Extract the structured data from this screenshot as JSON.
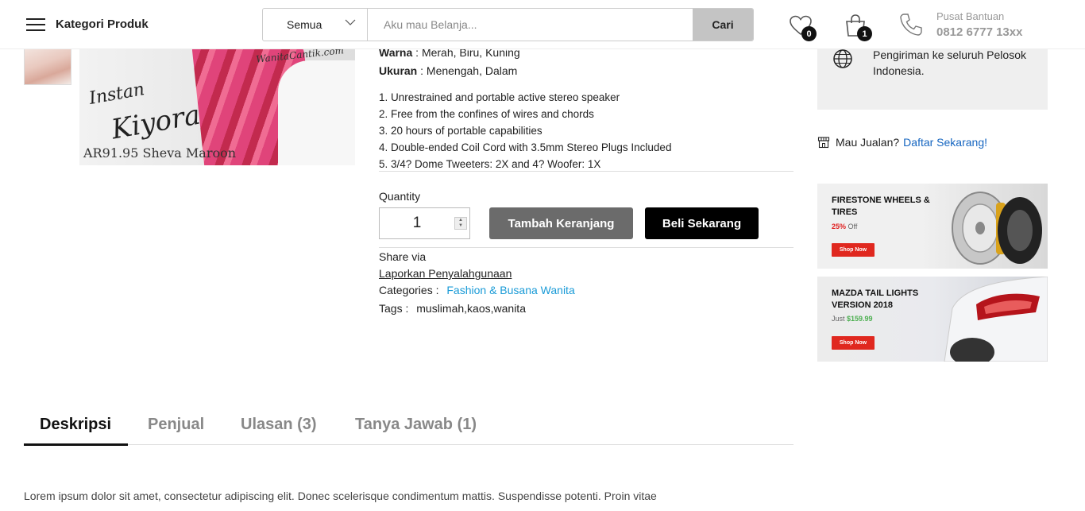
{
  "header": {
    "category_menu_label": "Kategori Produk",
    "search": {
      "category_selected": "Semua",
      "placeholder": "Aku mau Belanja...",
      "button_label": "Cari"
    },
    "wishlist_count": "0",
    "cart_count": "1",
    "help": {
      "label": "Pusat Bantuan",
      "phone": "0812 6777 13xx"
    }
  },
  "product_image": {
    "watermark": "WanitaCantik.com",
    "text_line1": "Instan",
    "text_line2": "Kiyora",
    "caption": "AR91.95 Sheva Maroon"
  },
  "product": {
    "color_label": "Warna",
    "color_value": " : Merah, Biru, Kuning",
    "size_label": "Ukuran",
    "size_value": " : Menengah, Dalam",
    "features": [
      "1. Unrestrained and portable active stereo speaker",
      "2. Free from the confines of wires and chords",
      "3. 20 hours of portable capabilities",
      "4. Double-ended Coil Cord with 3.5mm Stereo Plugs Included",
      "5. 3/4? Dome Tweeters: 2X and 4? Woofer: 1X"
    ],
    "quantity_label": "Quantity",
    "quantity_value": "1",
    "add_to_cart_label": "Tambah Keranjang",
    "buy_now_label": "Beli Sekarang",
    "share_label": "Share via",
    "report_label": "Laporkan Penyalahgunaan",
    "categories_label": "Categories :",
    "categories_value": "Fashion & Busana Wanita",
    "tags_label": "Tags :",
    "tags_value": "muslimah,kaos,wanita"
  },
  "sidebar": {
    "shipping_text": "Pengiriman ke seluruh Pelosok Indonesia.",
    "seller_prompt": "Mau Jualan?",
    "seller_link": "Daftar Sekarang!",
    "banners": [
      {
        "title": "FIRESTONE WHEELS & TIRES",
        "discount": "25%",
        "discount_suffix": " Off",
        "button": "Shop Now"
      },
      {
        "title": "MAZDA TAIL LIGHTS VERSION 2018",
        "price_prefix": "Just ",
        "price": "$159.99",
        "button": "Shop Now"
      }
    ]
  },
  "tabs": [
    {
      "label": "Deskripsi"
    },
    {
      "label": "Penjual"
    },
    {
      "label": "Ulasan (3)"
    },
    {
      "label": "Tanya Jawab (1)"
    }
  ],
  "description": "Lorem ipsum dolor sit amet, consectetur adipiscing elit. Donec scelerisque condimentum mattis. Suspendisse potenti. Proin vitae"
}
